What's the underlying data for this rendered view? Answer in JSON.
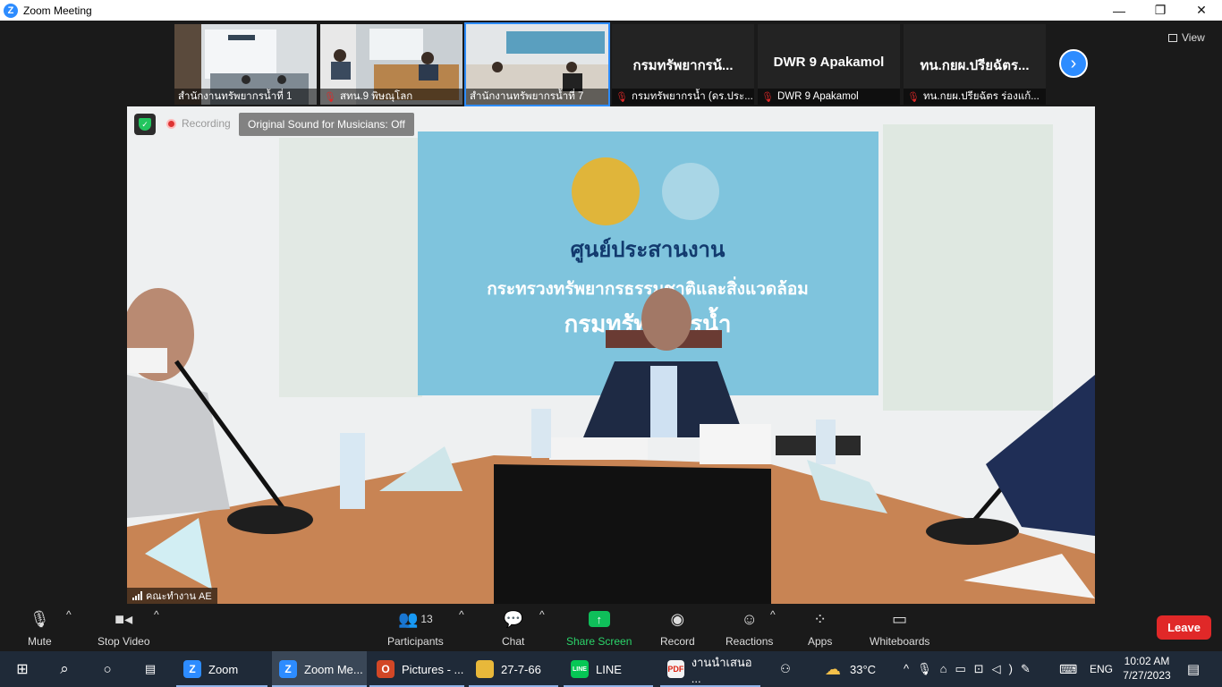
{
  "window": {
    "title": "Zoom Meeting"
  },
  "thumbnails": [
    {
      "name": "สำนักงานทรัพยากรน้ำที่ 1",
      "muted": false,
      "video": true,
      "active": false
    },
    {
      "name": "สทน.9 พิษณุโลก",
      "muted": true,
      "video": true,
      "active": false
    },
    {
      "name": "สำนักงานทรัพยากรน้ำที่ 7",
      "muted": false,
      "video": true,
      "active": true
    },
    {
      "name": "กรมทรัพยากรน้ำ (ดร.ประ...",
      "display": "กรมทรัพยากรน้...",
      "muted": true,
      "video": false,
      "active": false
    },
    {
      "name": "DWR 9 Apakamol",
      "display": "DWR 9 Apakamol",
      "muted": true,
      "video": false,
      "active": false
    },
    {
      "name": "ทน.กยผ.ปรียฉัตร ร่องแก้...",
      "display": "ทน.กยผ.ปรียฉัตร...",
      "muted": true,
      "video": false,
      "active": false
    }
  ],
  "view_label": "View",
  "main": {
    "recording_label": "Recording",
    "original_sound_label": "Original Sound for Musicians: Off",
    "speaker_name": "คณะทำงาน AE",
    "banner_line1": "ศูนย์ประสานงาน",
    "banner_line2": "กระทรวงทรัพยากรธรรมชาติและสิ่งแวดล้อม",
    "banner_line3": "กรมทรัพยากรน้ำ"
  },
  "toolbar": {
    "mute": "Mute",
    "stop_video": "Stop Video",
    "participants": "Participants",
    "participants_count": "13",
    "chat": "Chat",
    "share_screen": "Share Screen",
    "record": "Record",
    "reactions": "Reactions",
    "apps": "Apps",
    "whiteboards": "Whiteboards",
    "leave": "Leave"
  },
  "taskbar": {
    "apps": [
      {
        "label": "Zoom",
        "icon": "zoom-icon"
      },
      {
        "label": "Zoom Me...",
        "icon": "zoom-icon"
      },
      {
        "label": "Pictures - ...",
        "icon": "office-icon"
      },
      {
        "label": "27-7-66",
        "icon": "folder-icon"
      },
      {
        "label": "LINE",
        "icon": "line-icon"
      },
      {
        "label": "งานนำเสนอ ...",
        "icon": "pdf-icon"
      }
    ],
    "weather": "33°C",
    "language": "ENG",
    "time": "10:02 AM",
    "date": "7/27/2023"
  }
}
